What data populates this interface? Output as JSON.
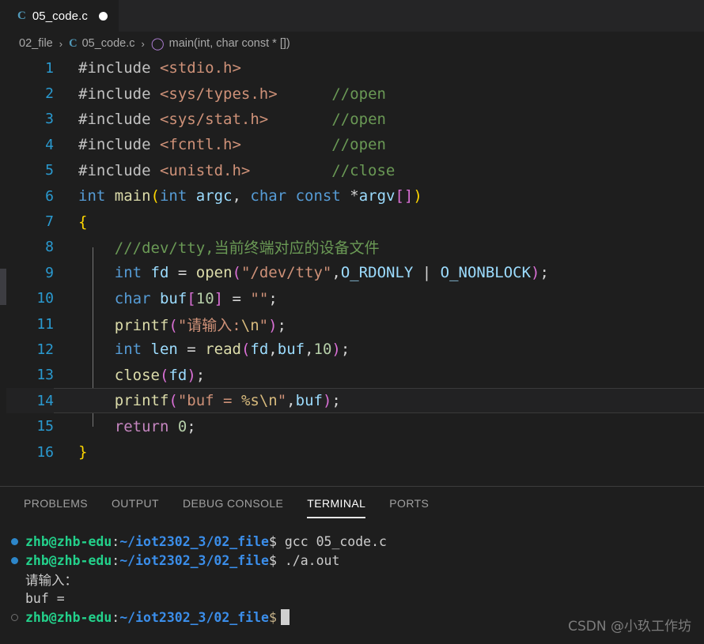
{
  "tab": {
    "file_icon": "c-file-icon",
    "name": "05_code.c",
    "dirty_indicator": "unsaved-dot"
  },
  "breadcrumb": {
    "folder": "02_file",
    "sep": "›",
    "file": "05_code.c",
    "symbol": "main(int, char const * [])",
    "symbol_icon": "cube-icon"
  },
  "editor": {
    "language": "c",
    "active_line": 14,
    "lines": [
      {
        "n": "1",
        "tokens": [
          {
            "t": "#include ",
            "c": "k-pre"
          },
          {
            "t": "<stdio.h>",
            "c": "k-hdr"
          }
        ]
      },
      {
        "n": "2",
        "tokens": [
          {
            "t": "#include ",
            "c": "k-pre"
          },
          {
            "t": "<sys/types.h>",
            "c": "k-hdr"
          },
          {
            "t": "      ",
            "c": "k-op"
          },
          {
            "t": "//open",
            "c": "k-cmt"
          }
        ]
      },
      {
        "n": "3",
        "tokens": [
          {
            "t": "#include ",
            "c": "k-pre"
          },
          {
            "t": "<sys/stat.h>",
            "c": "k-hdr"
          },
          {
            "t": "       ",
            "c": "k-op"
          },
          {
            "t": "//open",
            "c": "k-cmt"
          }
        ]
      },
      {
        "n": "4",
        "tokens": [
          {
            "t": "#include ",
            "c": "k-pre"
          },
          {
            "t": "<fcntl.h>",
            "c": "k-hdr"
          },
          {
            "t": "          ",
            "c": "k-op"
          },
          {
            "t": "//open",
            "c": "k-cmt"
          }
        ]
      },
      {
        "n": "5",
        "tokens": [
          {
            "t": "#include ",
            "c": "k-pre"
          },
          {
            "t": "<unistd.h>",
            "c": "k-hdr"
          },
          {
            "t": "         ",
            "c": "k-op"
          },
          {
            "t": "//close",
            "c": "k-cmt"
          }
        ]
      },
      {
        "n": "6",
        "tokens": [
          {
            "t": "int ",
            "c": "k-kw"
          },
          {
            "t": "main",
            "c": "k-fn"
          },
          {
            "t": "(",
            "c": "k-p1"
          },
          {
            "t": "int ",
            "c": "k-kw"
          },
          {
            "t": "argc",
            "c": "k-var"
          },
          {
            "t": ", ",
            "c": "k-op"
          },
          {
            "t": "char ",
            "c": "k-kw"
          },
          {
            "t": "const ",
            "c": "k-kw"
          },
          {
            "t": "*",
            "c": "k-op"
          },
          {
            "t": "argv",
            "c": "k-var"
          },
          {
            "t": "[]",
            "c": "k-p2"
          },
          {
            "t": ")",
            "c": "k-p1"
          }
        ]
      },
      {
        "n": "7",
        "tokens": [
          {
            "t": "{",
            "c": "k-p1"
          }
        ]
      },
      {
        "n": "8",
        "tokens": [
          {
            "t": "    ///dev/tty,当前终端对应的设备文件",
            "c": "k-cmt"
          }
        ]
      },
      {
        "n": "9",
        "tokens": [
          {
            "t": "    ",
            "c": "k-op"
          },
          {
            "t": "int ",
            "c": "k-kw"
          },
          {
            "t": "fd ",
            "c": "k-var"
          },
          {
            "t": "= ",
            "c": "k-op"
          },
          {
            "t": "open",
            "c": "k-fn"
          },
          {
            "t": "(",
            "c": "k-p2"
          },
          {
            "t": "\"/dev/tty\"",
            "c": "k-str"
          },
          {
            "t": ",",
            "c": "k-op"
          },
          {
            "t": "O_RDONLY ",
            "c": "k-var"
          },
          {
            "t": "| ",
            "c": "k-op"
          },
          {
            "t": "O_NONBLOCK",
            "c": "k-var"
          },
          {
            "t": ")",
            "c": "k-p2"
          },
          {
            "t": ";",
            "c": "k-op"
          }
        ]
      },
      {
        "n": "10",
        "tokens": [
          {
            "t": "    ",
            "c": "k-op"
          },
          {
            "t": "char ",
            "c": "k-kw"
          },
          {
            "t": "buf",
            "c": "k-var"
          },
          {
            "t": "[",
            "c": "k-p2"
          },
          {
            "t": "10",
            "c": "k-num"
          },
          {
            "t": "]",
            "c": "k-p2"
          },
          {
            "t": " = ",
            "c": "k-op"
          },
          {
            "t": "\"\"",
            "c": "k-str"
          },
          {
            "t": ";",
            "c": "k-op"
          }
        ]
      },
      {
        "n": "11",
        "tokens": [
          {
            "t": "    ",
            "c": "k-op"
          },
          {
            "t": "printf",
            "c": "k-fn"
          },
          {
            "t": "(",
            "c": "k-p2"
          },
          {
            "t": "\"请输入:",
            "c": "k-str"
          },
          {
            "t": "\\n",
            "c": "k-esc"
          },
          {
            "t": "\"",
            "c": "k-str"
          },
          {
            "t": ")",
            "c": "k-p2"
          },
          {
            "t": ";",
            "c": "k-op"
          }
        ]
      },
      {
        "n": "12",
        "tokens": [
          {
            "t": "    ",
            "c": "k-op"
          },
          {
            "t": "int ",
            "c": "k-kw"
          },
          {
            "t": "len ",
            "c": "k-var"
          },
          {
            "t": "= ",
            "c": "k-op"
          },
          {
            "t": "read",
            "c": "k-fn"
          },
          {
            "t": "(",
            "c": "k-p2"
          },
          {
            "t": "fd",
            "c": "k-var"
          },
          {
            "t": ",",
            "c": "k-op"
          },
          {
            "t": "buf",
            "c": "k-var"
          },
          {
            "t": ",",
            "c": "k-op"
          },
          {
            "t": "10",
            "c": "k-num"
          },
          {
            "t": ")",
            "c": "k-p2"
          },
          {
            "t": ";",
            "c": "k-op"
          }
        ]
      },
      {
        "n": "13",
        "tokens": [
          {
            "t": "    ",
            "c": "k-op"
          },
          {
            "t": "close",
            "c": "k-fn"
          },
          {
            "t": "(",
            "c": "k-p2"
          },
          {
            "t": "fd",
            "c": "k-var"
          },
          {
            "t": ")",
            "c": "k-p2"
          },
          {
            "t": ";",
            "c": "k-op"
          }
        ]
      },
      {
        "n": "14",
        "tokens": [
          {
            "t": "    ",
            "c": "k-op"
          },
          {
            "t": "printf",
            "c": "k-fn"
          },
          {
            "t": "(",
            "c": "k-p2"
          },
          {
            "t": "\"buf = ",
            "c": "k-str"
          },
          {
            "t": "%s",
            "c": "k-esc"
          },
          {
            "t": "\\n",
            "c": "k-esc"
          },
          {
            "t": "\"",
            "c": "k-str"
          },
          {
            "t": ",",
            "c": "k-op"
          },
          {
            "t": "buf",
            "c": "k-var"
          },
          {
            "t": ")",
            "c": "k-p2"
          },
          {
            "t": ";",
            "c": "k-op"
          }
        ]
      },
      {
        "n": "15",
        "tokens": [
          {
            "t": "    ",
            "c": "k-op"
          },
          {
            "t": "return ",
            "c": "k-ctl"
          },
          {
            "t": "0",
            "c": "k-num"
          },
          {
            "t": ";",
            "c": "k-op"
          }
        ]
      },
      {
        "n": "16",
        "tokens": [
          {
            "t": "}",
            "c": "k-p1"
          }
        ]
      }
    ]
  },
  "panel": {
    "tabs": [
      {
        "label": "PROBLEMS",
        "active": false
      },
      {
        "label": "OUTPUT",
        "active": false
      },
      {
        "label": "DEBUG CONSOLE",
        "active": false
      },
      {
        "label": "TERMINAL",
        "active": true
      },
      {
        "label": "PORTS",
        "active": false
      }
    ]
  },
  "terminal": {
    "lines": [
      {
        "deco": "dot-filled",
        "user": "zhb@zhb-edu",
        "colon": ":",
        "path": "~/iot2302_3/02_file",
        "dollar": "$",
        "cmd": " gcc 05_code.c"
      },
      {
        "deco": "dot-filled",
        "user": "zhb@zhb-edu",
        "colon": ":",
        "path": "~/iot2302_3/02_file",
        "dollar": "$",
        "cmd": " ./a.out"
      },
      {
        "deco": "none",
        "output": "请输入："
      },
      {
        "deco": "none",
        "output": "buf = "
      },
      {
        "deco": "dot-hollow",
        "user": "zhb@zhb-edu",
        "colon": ":",
        "path": "~/iot2302_3/02_file",
        "dollar": "$",
        "cmd": "",
        "cursor": true
      }
    ]
  },
  "watermark": {
    "text": "CSDN @小玖工作坊"
  },
  "colors": {
    "editor_bg": "#1e1e1e",
    "tabbar_bg": "#252526",
    "accent_blue": "#3b8eea",
    "prompt_green": "#23d18b",
    "linenumber": "#2a9ad0",
    "comment_green": "#6a9955",
    "string_orange": "#ce9178",
    "keyword_blue": "#569cd6",
    "function_yellow": "#dcdcaa"
  }
}
